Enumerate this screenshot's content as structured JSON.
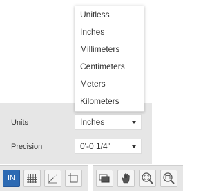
{
  "settings_panel": {
    "units_label": "Units",
    "units_value": "Inches",
    "precision_label": "Precision",
    "precision_value": "0'-0 1/4\""
  },
  "units_dropdown": {
    "options": [
      "Unitless",
      "Inches",
      "Millimeters",
      "Centimeters",
      "Meters",
      "Kilometers"
    ],
    "selected": "Inches"
  },
  "toolbar": {
    "units_button_label": "IN",
    "left_buttons": [
      "units-toggle",
      "grid-icon",
      "angle-measure-icon",
      "frame-icon"
    ],
    "right_buttons": [
      "layers-icon",
      "pan-hand-icon",
      "zoom-fit-icon",
      "zoom-out-icon"
    ]
  },
  "colors": {
    "panel_bg": "#e6e6e6",
    "active_button": "#2d6ab3",
    "text": "#333333"
  }
}
